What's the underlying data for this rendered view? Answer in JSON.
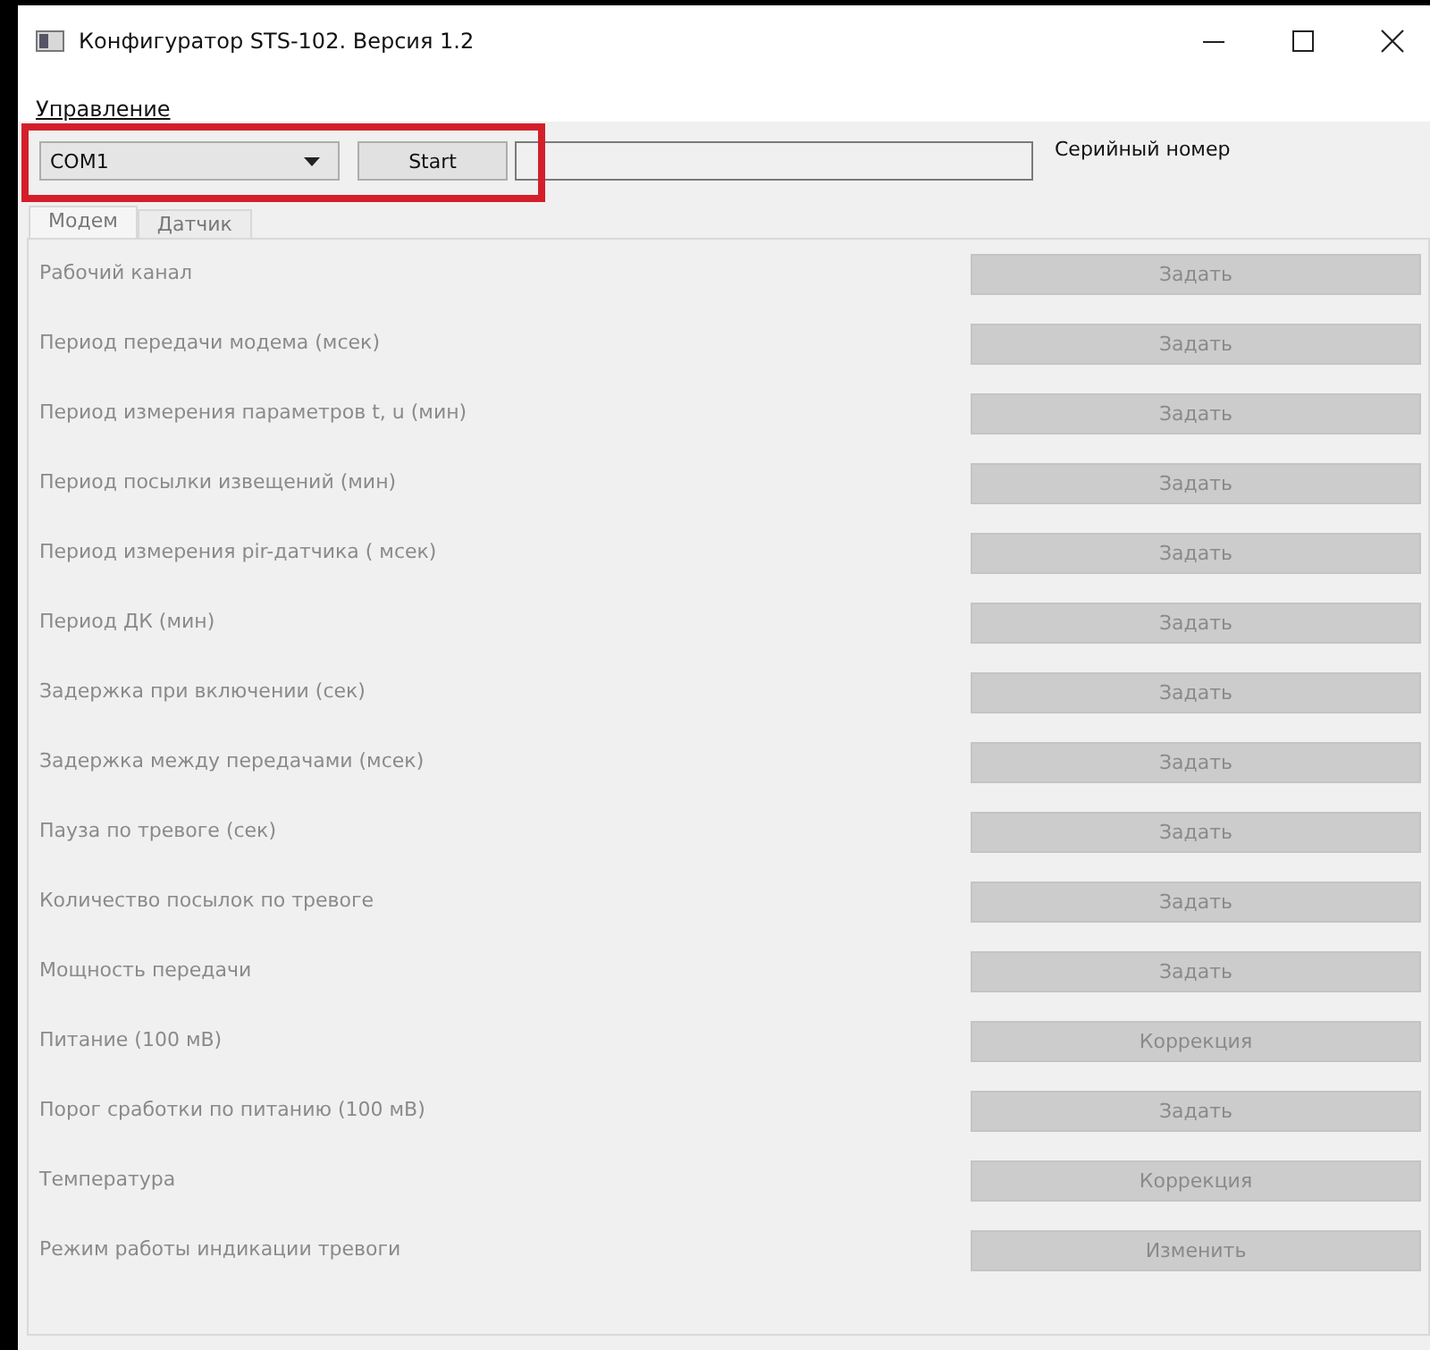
{
  "window": {
    "title": "Конфигуратор STS-102. Версия 1.2"
  },
  "menu": [
    {
      "label": "Управление"
    }
  ],
  "toolbar": {
    "port": {
      "value": "COM1"
    },
    "start_button": "Start",
    "serial_label": "Серийный номер",
    "highlighted": true
  },
  "tabs": [
    {
      "label": "Модем",
      "selected": true
    },
    {
      "label": "Датчик",
      "selected": false
    }
  ],
  "rows": [
    {
      "label": "Рабочий канал",
      "button": "Задать",
      "disabled": true
    },
    {
      "label": "Период передачи модема (мсек)",
      "button": "Задать",
      "disabled": true
    },
    {
      "label": "Период измерения параметров t, u (мин)",
      "button": "Задать",
      "disabled": true
    },
    {
      "label": "Период посылки извещений (мин)",
      "button": "Задать",
      "disabled": true
    },
    {
      "label": "Период измерения pir-датчика ( мсек)",
      "button": "Задать",
      "disabled": true
    },
    {
      "label": "Период ДК (мин)",
      "button": "Задать",
      "disabled": true
    },
    {
      "label": "Задержка при включении (сек)",
      "button": "Задать",
      "disabled": true
    },
    {
      "label": "Задержка между передачами (мсек)",
      "button": "Задать",
      "disabled": true
    },
    {
      "label": "Пауза по тревоге (сек)",
      "button": "Задать",
      "disabled": true
    },
    {
      "label": "Количество посылок по тревоге",
      "button": "Задать",
      "disabled": true
    },
    {
      "label": "Мощность передачи",
      "button": "Задать",
      "disabled": true
    },
    {
      "label": "Питание   (100 мВ)",
      "button": "Коррекция",
      "disabled": true
    },
    {
      "label": "Порог сработки по питанию (100 мВ)",
      "button": "Задать",
      "disabled": true
    },
    {
      "label": "Температура",
      "button": "Коррекция",
      "disabled": true
    },
    {
      "label": "Режим работы индикации тревоги",
      "button": "Изменить",
      "disabled": true
    }
  ]
}
